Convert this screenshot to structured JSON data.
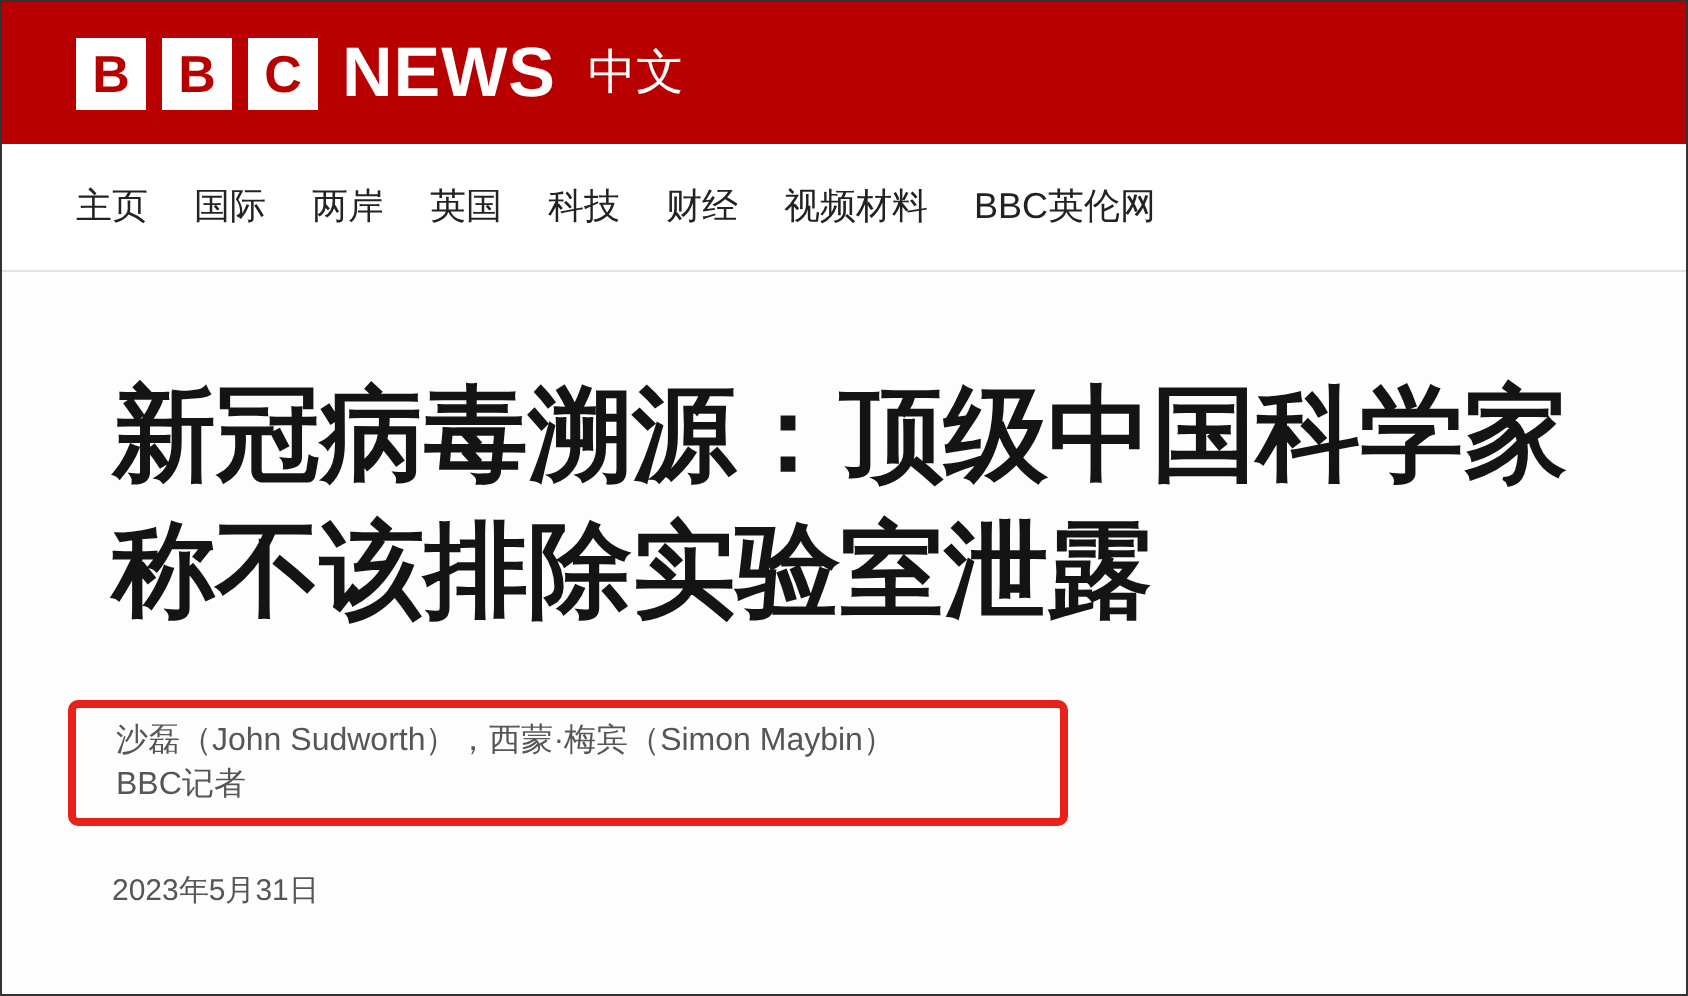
{
  "header": {
    "logo_letters": [
      "B",
      "B",
      "C"
    ],
    "logo_word": "NEWS",
    "edition": "中文"
  },
  "nav": {
    "items": [
      "主页",
      "国际",
      "两岸",
      "英国",
      "科技",
      "财经",
      "视频材料",
      "BBC英伦网"
    ]
  },
  "article": {
    "headline": "新冠病毒溯源：顶级中国科学家称不该排除实验室泄露",
    "byline": {
      "highlighted": true,
      "authors": "沙磊（John Sudworth），西蒙·梅宾（Simon Maybin）",
      "role": "BBC记者"
    },
    "date": "2023年5月31日"
  }
}
